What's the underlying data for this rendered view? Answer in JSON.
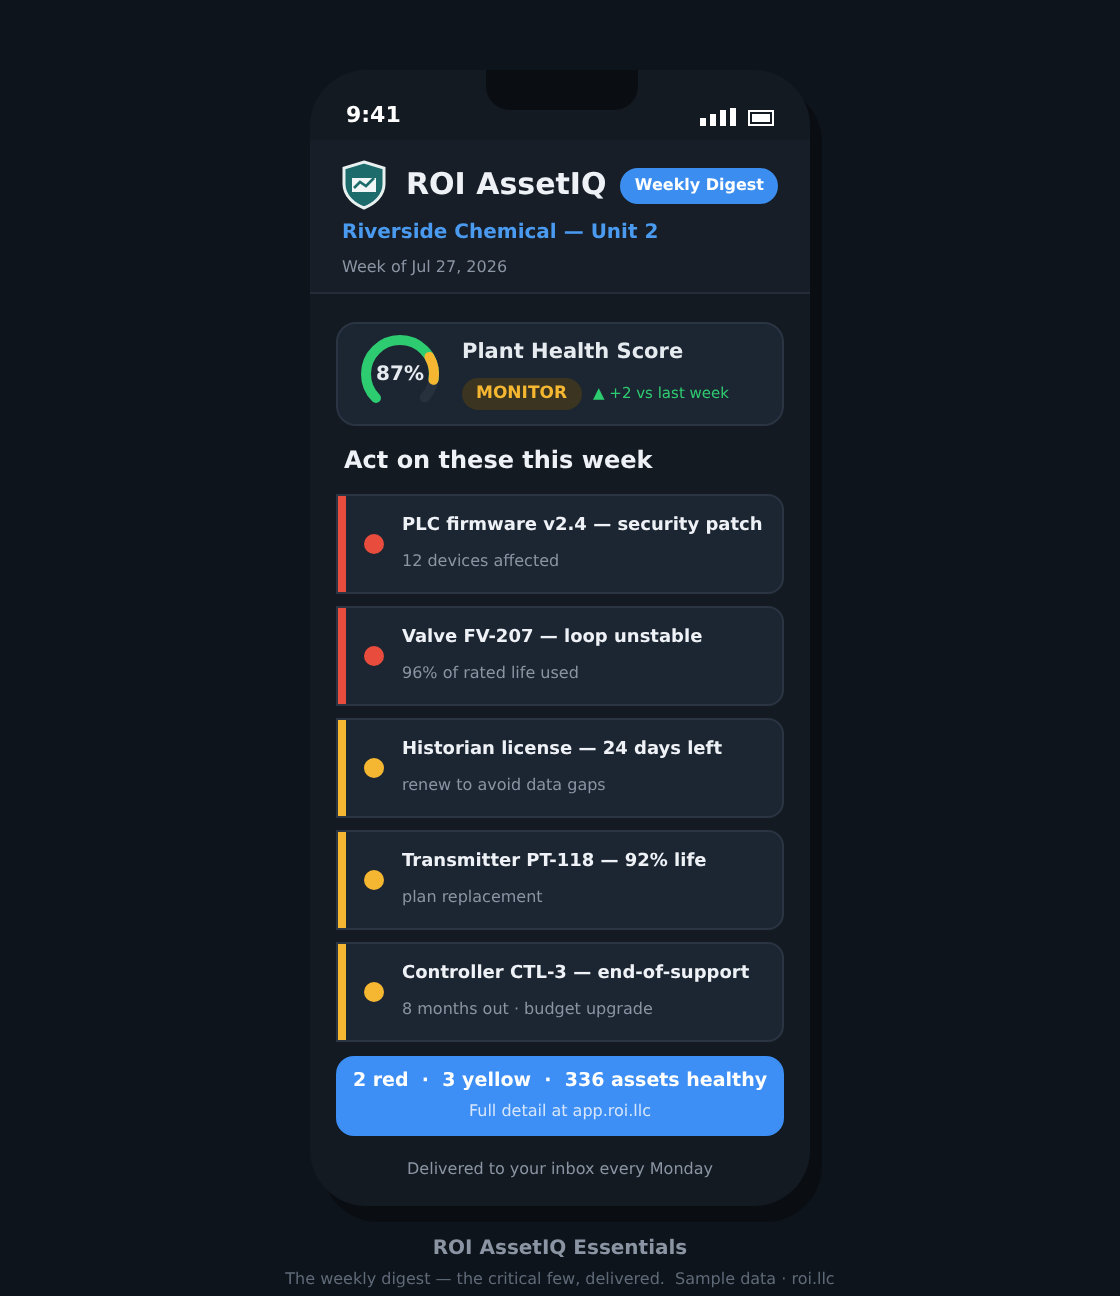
{
  "status_bar": {
    "time": "9:41"
  },
  "header": {
    "app_name": "ROI AssetIQ",
    "badge": "Weekly Digest",
    "site": "Riverside Chemical — Unit 2",
    "week": "Week of Jul 27, 2026"
  },
  "health": {
    "title": "Plant Health Score",
    "score": "87%",
    "level": 0.87,
    "status": "MONITOR",
    "trend": "▲ +2 vs last week"
  },
  "section_title": "Act on these this week",
  "actions": [
    {
      "title": "PLC firmware v2.4 — security patch",
      "detail": "12 devices affected",
      "color": "#e74c3c"
    },
    {
      "title": "Valve FV-207 — loop unstable",
      "detail": "96% of rated life used",
      "color": "#e74c3c"
    },
    {
      "title": "Historian license — 24 days left",
      "detail": "renew to avoid data gaps",
      "color": "#f5b731"
    },
    {
      "title": "Transmitter PT-118 — 92% life",
      "detail": "plan replacement",
      "color": "#f5b731"
    },
    {
      "title": "Controller CTL-3 — end-of-support",
      "detail": "8 months out · budget upgrade",
      "color": "#f5b731"
    }
  ],
  "summary": {
    "counts": "2 red  ·  3 yellow  ·  336 assets healthy",
    "link": "Full detail at app.roi.llc"
  },
  "footer_note": "Delivered to your inbox every Monday",
  "caption": {
    "title": "ROI AssetIQ Essentials",
    "subtitle": "The weekly digest — the critical few, delivered.  Sample data · roi.llc"
  }
}
